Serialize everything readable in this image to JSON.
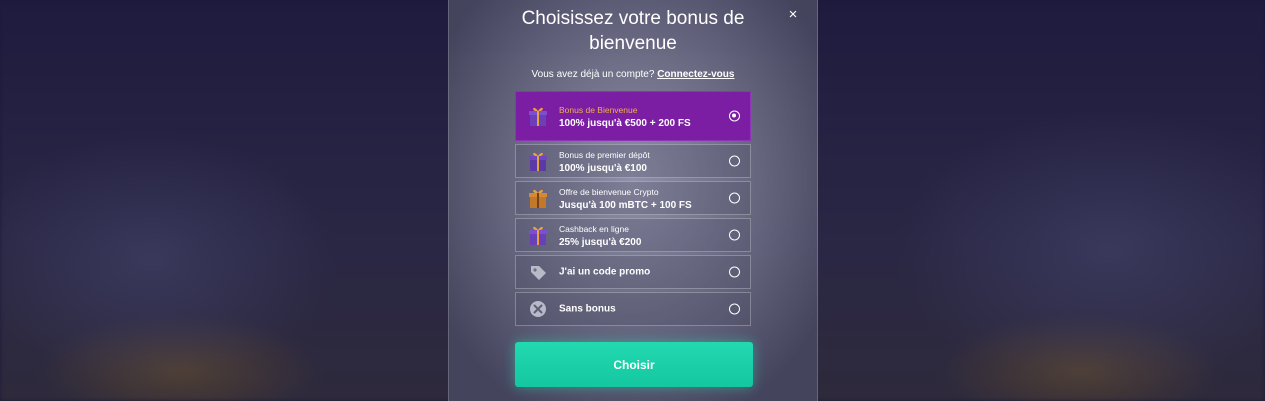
{
  "modal": {
    "title": "Choisissez votre bonus de bienvenue",
    "close_label": "×",
    "login_prompt": "Vous avez déjà un compte?",
    "login_link": "Connectez-vous",
    "cta_label": "Choisir"
  },
  "options": [
    {
      "sub": "Bonus de Bienvenue",
      "main": "100% jusqu'à €500 + 200 FS",
      "icon": "gift-icon",
      "selected": true
    },
    {
      "sub": "Bonus de premier dépôt",
      "main": "100% jusqu'à €100",
      "icon": "gift-icon",
      "selected": false
    },
    {
      "sub": "Offre de bienvenue Crypto",
      "main": "Jusqu'à 100 mBTC + 100 FS",
      "icon": "gift-icon",
      "selected": false
    },
    {
      "sub": "Cashback en ligne",
      "main": "25% jusqu'à €200",
      "icon": "gift-icon",
      "selected": false
    },
    {
      "main": "J'ai un code promo",
      "icon": "tag-icon",
      "selected": false
    },
    {
      "main": "Sans bonus",
      "icon": "no-bonus-icon",
      "selected": false
    }
  ],
  "colors": {
    "selected_bg": "#7b1ea3",
    "selected_subtext": "#f0b14a",
    "cta_bg": "#1ccfa7"
  }
}
